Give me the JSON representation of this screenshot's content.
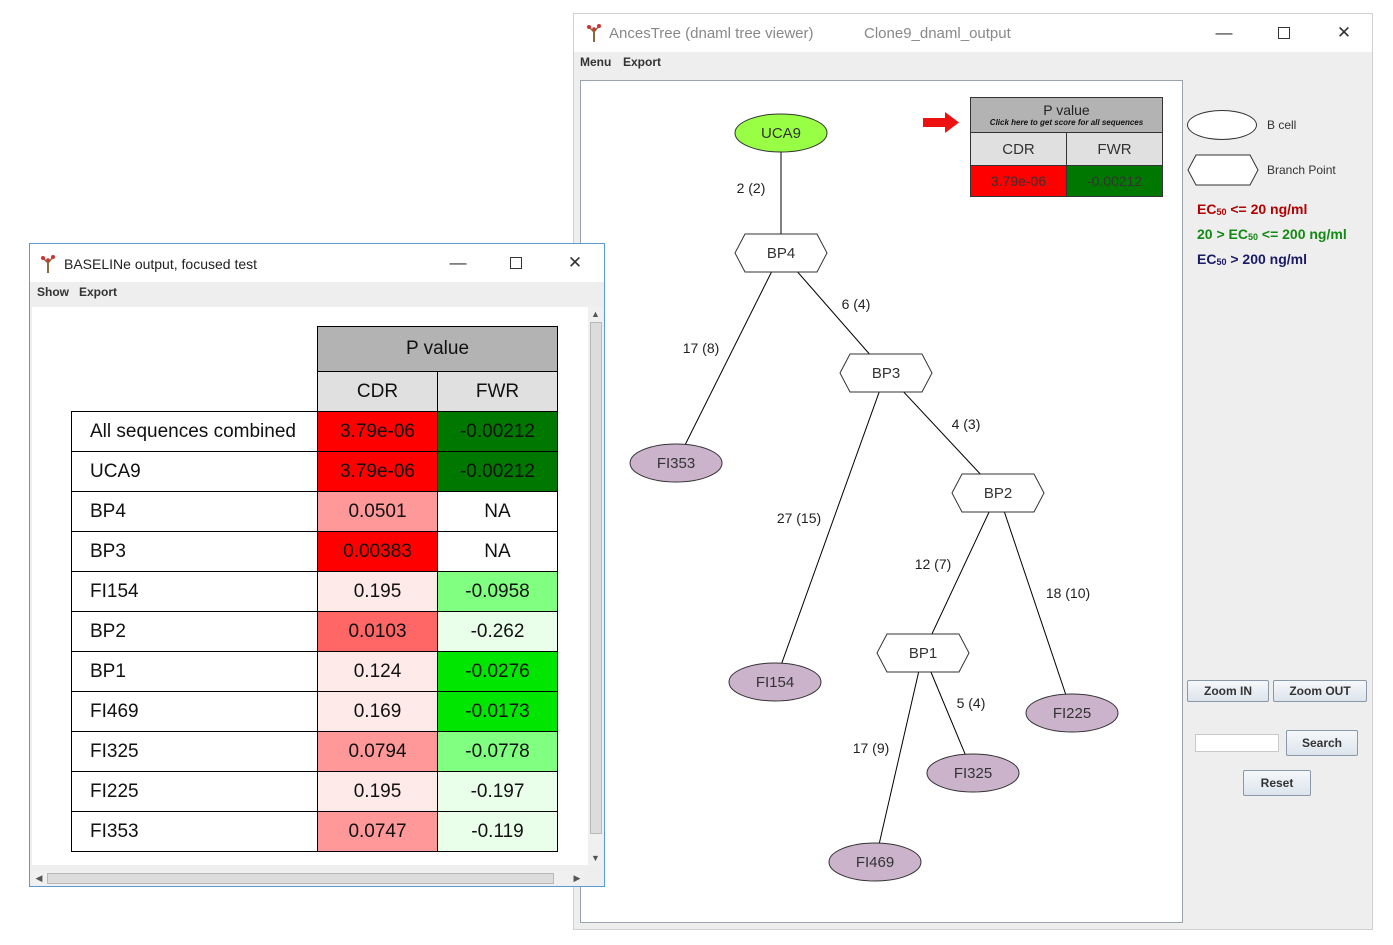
{
  "ancestree": {
    "app_title": "AncesTree (dnaml tree viewer)",
    "file_title": "Clone9_dnaml_output",
    "menu": [
      "Menu",
      "Export"
    ],
    "pvalue_table": {
      "header": "P value",
      "subheader": "Click here to get score for all sequences",
      "col_cdr": "CDR",
      "col_fwr": "FWR",
      "cdr_value": "3.79e-06",
      "fwr_value": "-0.00212",
      "cdr_color": "#ff0000",
      "fwr_color": "#007800"
    },
    "tree": {
      "nodes": [
        {
          "id": "UCA9",
          "label": "UCA9",
          "type": "b-cell",
          "color": "#99ff44"
        },
        {
          "id": "BP4",
          "label": "BP4",
          "type": "branch-point"
        },
        {
          "id": "BP3",
          "label": "BP3",
          "type": "branch-point"
        },
        {
          "id": "BP2",
          "label": "BP2",
          "type": "branch-point"
        },
        {
          "id": "BP1",
          "label": "BP1",
          "type": "branch-point"
        },
        {
          "id": "FI353",
          "label": "FI353",
          "type": "b-cell",
          "color": "#ccb3cc"
        },
        {
          "id": "FI154",
          "label": "FI154",
          "type": "b-cell",
          "color": "#ccb3cc"
        },
        {
          "id": "FI225",
          "label": "FI225",
          "type": "b-cell",
          "color": "#ccb3cc"
        },
        {
          "id": "FI325",
          "label": "FI325",
          "type": "b-cell",
          "color": "#ccb3cc"
        },
        {
          "id": "FI469",
          "label": "FI469",
          "type": "b-cell",
          "color": "#ccb3cc"
        }
      ],
      "edges": [
        {
          "from": "UCA9",
          "to": "BP4",
          "label": "2 (2)"
        },
        {
          "from": "BP4",
          "to": "FI353",
          "label": "17 (8)"
        },
        {
          "from": "BP4",
          "to": "BP3",
          "label": "6 (4)"
        },
        {
          "from": "BP3",
          "to": "FI154",
          "label": "27 (15)"
        },
        {
          "from": "BP3",
          "to": "BP2",
          "label": "4 (3)"
        },
        {
          "from": "BP2",
          "to": "BP1",
          "label": "12 (7)"
        },
        {
          "from": "BP2",
          "to": "FI225",
          "label": "18 (10)"
        },
        {
          "from": "BP1",
          "to": "FI469",
          "label": "17 (9)"
        },
        {
          "from": "BP1",
          "to": "FI325",
          "label": "5 (4)"
        }
      ]
    },
    "legend": {
      "b_cell": "B cell",
      "branch_point": "Branch Point",
      "ec_lines": [
        {
          "pre": "EC",
          "sub": "50",
          "post": " <= 20 ng/ml",
          "color": "#b30000",
          "post_color": "#b30000"
        },
        {
          "pre": "20 > EC",
          "sub": "50",
          "post": " <= 200 ng/ml",
          "color": "#138a13",
          "post_color": "#138a13"
        },
        {
          "pre": "EC",
          "sub": "50",
          "post": " > 200 ng/ml",
          "color": "#1a1a66",
          "post_color": "#1a1a66"
        }
      ]
    },
    "buttons": {
      "zoom_in": "Zoom IN",
      "zoom_out": "Zoom OUT",
      "search": "Search",
      "reset": "Reset"
    },
    "search_value": ""
  },
  "baseline": {
    "title": "BASELINe output, focused test",
    "menu": [
      "Show",
      "Export"
    ],
    "table": {
      "header": "P value",
      "col_cdr": "CDR",
      "col_fwr": "FWR",
      "rows": [
        {
          "label": "All sequences combined",
          "cdr": "3.79e-06",
          "fwr": "-0.00212",
          "cdr_color": "#ff0000",
          "fwr_color": "#007800"
        },
        {
          "label": "UCA9",
          "cdr": "3.79e-06",
          "fwr": "-0.00212",
          "cdr_color": "#ff0000",
          "fwr_color": "#007800"
        },
        {
          "label": "BP4",
          "cdr": "0.0501",
          "fwr": "NA",
          "cdr_color": "#ff9999",
          "fwr_color": "#ffffff"
        },
        {
          "label": "BP3",
          "cdr": "0.00383",
          "fwr": "NA",
          "cdr_color": "#ff0000",
          "fwr_color": "#ffffff"
        },
        {
          "label": "FI154",
          "cdr": "0.195",
          "fwr": "-0.0958",
          "cdr_color": "#ffeaea",
          "fwr_color": "#80ff80"
        },
        {
          "label": "BP2",
          "cdr": "0.0103",
          "fwr": "-0.262",
          "cdr_color": "#ff6666",
          "fwr_color": "#eaffea"
        },
        {
          "label": "BP1",
          "cdr": "0.124",
          "fwr": "-0.0276",
          "cdr_color": "#ffeaea",
          "fwr_color": "#00e600"
        },
        {
          "label": "FI469",
          "cdr": "0.169",
          "fwr": "-0.0173",
          "cdr_color": "#ffeaea",
          "fwr_color": "#00e600"
        },
        {
          "label": "FI325",
          "cdr": "0.0794",
          "fwr": "-0.0778",
          "cdr_color": "#ff9999",
          "fwr_color": "#80ff80"
        },
        {
          "label": "FI225",
          "cdr": "0.195",
          "fwr": "-0.197",
          "cdr_color": "#ffeaea",
          "fwr_color": "#eaffea"
        },
        {
          "label": "FI353",
          "cdr": "0.0747",
          "fwr": "-0.119",
          "cdr_color": "#ff9999",
          "fwr_color": "#eaffea"
        }
      ]
    }
  }
}
